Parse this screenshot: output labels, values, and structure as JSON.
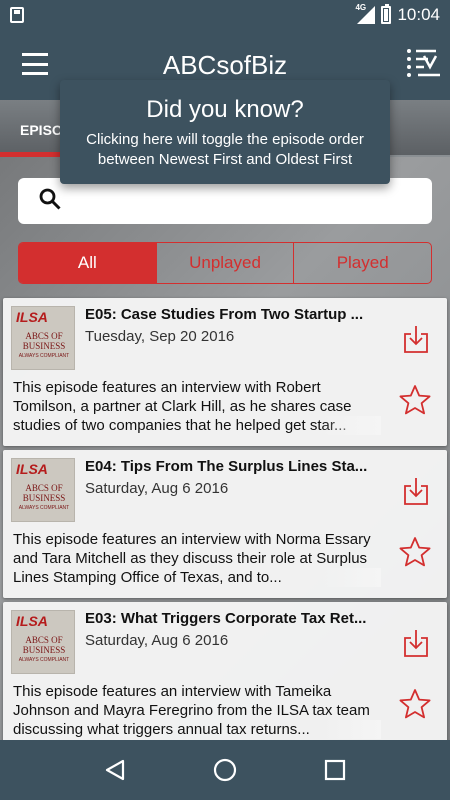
{
  "status_bar": {
    "network": "4G",
    "time": "10:04"
  },
  "app_bar": {
    "title": "ABCsofBiz",
    "menu_icon": "hamburger-icon",
    "sort_icon": "sort-order-icon"
  },
  "banner": {
    "episodes_label": "EPISO"
  },
  "tooltip": {
    "title": "Did you know?",
    "body": "Clicking here will toggle the episode order between Newest First and Oldest First"
  },
  "search": {
    "icon": "search-icon",
    "value": "",
    "placeholder": ""
  },
  "filters": {
    "tabs": [
      {
        "label": "All",
        "active": true
      },
      {
        "label": "Unplayed",
        "active": false
      },
      {
        "label": "Played",
        "active": false
      }
    ]
  },
  "podcast_art": {
    "line1": "ILSA",
    "line2": "ABCS OF BUSINESS",
    "line3": "ALWAYS COMPLIANT"
  },
  "episodes": [
    {
      "title": "E05: Case Studies From Two Startup ...",
      "date": "Tuesday, Sep 20 2016",
      "description": "This episode features an interview with Robert Tomilson, a partner at Clark Hill, as he shares case studies of two companies that he helped get star..."
    },
    {
      "title": "E04: Tips From The Surplus Lines Sta...",
      "date": "Saturday, Aug 6 2016",
      "description": "This episode features an interview with Norma Essary and Tara Mitchell as they discuss their role at Surplus Lines Stamping Office of Texas, and to..."
    },
    {
      "title": "E03: What Triggers Corporate Tax Ret...",
      "date": "Saturday, Aug 6 2016",
      "description": "This episode features an interview with Tameika Johnson and Mayra Feregrino  from the ILSA tax team discussing what triggers annual tax returns..."
    }
  ],
  "colors": {
    "primary": "#3d525f",
    "accent": "#d32f2f"
  },
  "nav_bar": {
    "back": "back-icon",
    "home": "home-icon",
    "recents": "recents-icon"
  }
}
